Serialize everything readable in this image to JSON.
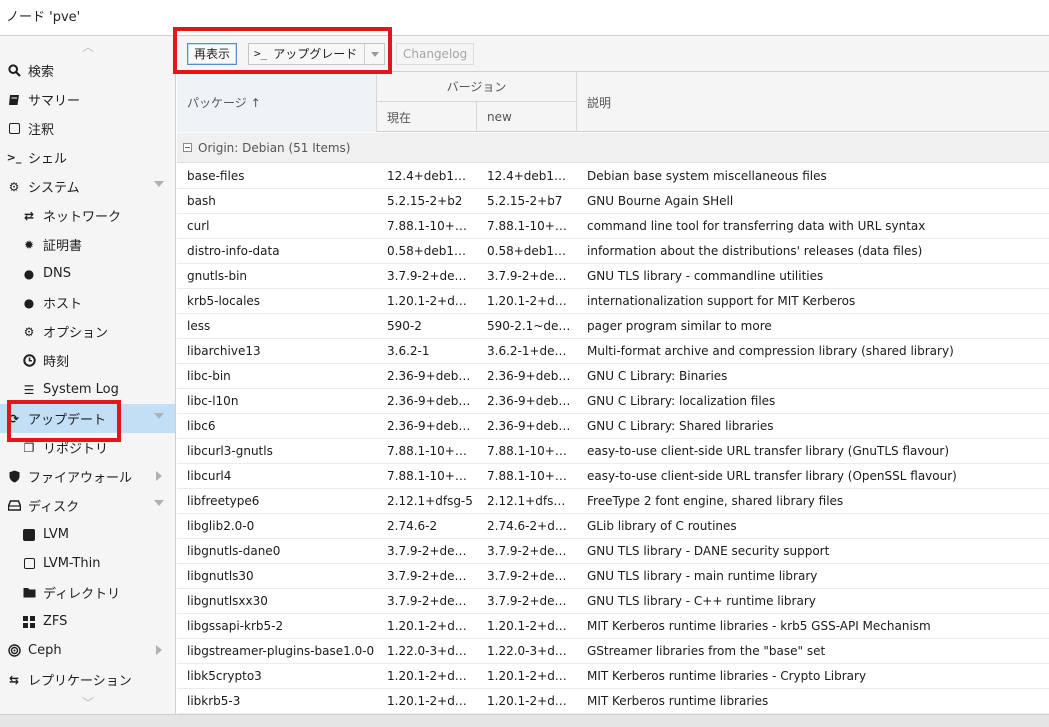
{
  "window": {
    "title": "ノード 'pve'"
  },
  "sidebar": {
    "items": [
      {
        "label": "検索",
        "icon": "search-icon",
        "name": "sidebar-item-search"
      },
      {
        "label": "サマリー",
        "icon": "book-icon",
        "name": "sidebar-item-summary"
      },
      {
        "label": "注釈",
        "icon": "note-icon",
        "name": "sidebar-item-notes"
      },
      {
        "label": "シェル",
        "icon": "terminal-icon",
        "name": "sidebar-item-shell"
      },
      {
        "label": "システム",
        "icon": "gears-icon",
        "name": "sidebar-item-system"
      },
      {
        "label": "ネットワーク",
        "icon": "exchange-icon",
        "name": "sidebar-item-network"
      },
      {
        "label": "証明書",
        "icon": "certificate-icon",
        "name": "sidebar-item-certificates"
      },
      {
        "label": "DNS",
        "icon": "globe-icon",
        "name": "sidebar-item-dns"
      },
      {
        "label": "ホスト",
        "icon": "globe-icon",
        "name": "sidebar-item-hosts"
      },
      {
        "label": "オプション",
        "icon": "gear-icon",
        "name": "sidebar-item-options"
      },
      {
        "label": "時刻",
        "icon": "clock-icon",
        "name": "sidebar-item-time"
      },
      {
        "label": "System Log",
        "icon": "list-icon",
        "name": "sidebar-item-syslog"
      },
      {
        "label": "アップデート",
        "icon": "refresh-icon",
        "name": "sidebar-item-updates"
      },
      {
        "label": "リポジトリ",
        "icon": "files-icon",
        "name": "sidebar-item-repositories"
      },
      {
        "label": "ファイアウォール",
        "icon": "shield-icon",
        "name": "sidebar-item-firewall"
      },
      {
        "label": "ディスク",
        "icon": "hdd-icon",
        "name": "sidebar-item-disks"
      },
      {
        "label": "LVM",
        "icon": "square-icon",
        "name": "sidebar-item-lvm"
      },
      {
        "label": "LVM-Thin",
        "icon": "square-outline-icon",
        "name": "sidebar-item-lvm-thin"
      },
      {
        "label": "ディレクトリ",
        "icon": "folder-icon",
        "name": "sidebar-item-directory"
      },
      {
        "label": "ZFS",
        "icon": "grid-icon",
        "name": "sidebar-item-zfs"
      },
      {
        "label": "Ceph",
        "icon": "ceph-icon",
        "name": "sidebar-item-ceph"
      },
      {
        "label": "レプリケーション",
        "icon": "retweet-icon",
        "name": "sidebar-item-replication"
      }
    ]
  },
  "toolbar": {
    "reload_label": "再表示",
    "upgrade_prompt": ">_",
    "upgrade_label": "アップグレード",
    "changelog_label": "Changelog"
  },
  "grid": {
    "headers": {
      "package": "パッケージ ↑",
      "version": "バージョン",
      "current": "現在",
      "new": "new",
      "description": "説明"
    },
    "group_label": "Origin: Debian (51 Items)",
    "rows": [
      {
        "pkg": "base-files",
        "cur": "12.4+deb1…",
        "new": "12.4+deb1…",
        "desc": "Debian base system miscellaneous files"
      },
      {
        "pkg": "bash",
        "cur": "5.2.15-2+b2",
        "new": "5.2.15-2+b7",
        "desc": "GNU Bourne Again SHell"
      },
      {
        "pkg": "curl",
        "cur": "7.88.1-10+…",
        "new": "7.88.1-10+…",
        "desc": "command line tool for transferring data with URL syntax"
      },
      {
        "pkg": "distro-info-data",
        "cur": "0.58+deb1…",
        "new": "0.58+deb1…",
        "desc": "information about the distributions' releases (data files)"
      },
      {
        "pkg": "gnutls-bin",
        "cur": "3.7.9-2+de…",
        "new": "3.7.9-2+de…",
        "desc": "GNU TLS library - commandline utilities"
      },
      {
        "pkg": "krb5-locales",
        "cur": "1.20.1-2+d…",
        "new": "1.20.1-2+d…",
        "desc": "internationalization support for MIT Kerberos"
      },
      {
        "pkg": "less",
        "cur": "590-2",
        "new": "590-2.1~de…",
        "desc": "pager program similar to more"
      },
      {
        "pkg": "libarchive13",
        "cur": "3.6.2-1",
        "new": "3.6.2-1+de…",
        "desc": "Multi-format archive and compression library (shared library)"
      },
      {
        "pkg": "libc-bin",
        "cur": "2.36-9+deb…",
        "new": "2.36-9+deb…",
        "desc": "GNU C Library: Binaries"
      },
      {
        "pkg": "libc-l10n",
        "cur": "2.36-9+deb…",
        "new": "2.36-9+deb…",
        "desc": "GNU C Library: localization files"
      },
      {
        "pkg": "libc6",
        "cur": "2.36-9+deb…",
        "new": "2.36-9+deb…",
        "desc": "GNU C Library: Shared libraries"
      },
      {
        "pkg": "libcurl3-gnutls",
        "cur": "7.88.1-10+…",
        "new": "7.88.1-10+…",
        "desc": "easy-to-use client-side URL transfer library (GnuTLS flavour)"
      },
      {
        "pkg": "libcurl4",
        "cur": "7.88.1-10+…",
        "new": "7.88.1-10+…",
        "desc": "easy-to-use client-side URL transfer library (OpenSSL flavour)"
      },
      {
        "pkg": "libfreetype6",
        "cur": "2.12.1+dfsg-5",
        "new": "2.12.1+dfs…",
        "desc": "FreeType 2 font engine, shared library files"
      },
      {
        "pkg": "libglib2.0-0",
        "cur": "2.74.6-2",
        "new": "2.74.6-2+d…",
        "desc": "GLib library of C routines"
      },
      {
        "pkg": "libgnutls-dane0",
        "cur": "3.7.9-2+de…",
        "new": "3.7.9-2+de…",
        "desc": "GNU TLS library - DANE security support"
      },
      {
        "pkg": "libgnutls30",
        "cur": "3.7.9-2+de…",
        "new": "3.7.9-2+de…",
        "desc": "GNU TLS library - main runtime library"
      },
      {
        "pkg": "libgnutlsxx30",
        "cur": "3.7.9-2+de…",
        "new": "3.7.9-2+de…",
        "desc": "GNU TLS library - C++ runtime library"
      },
      {
        "pkg": "libgssapi-krb5-2",
        "cur": "1.20.1-2+d…",
        "new": "1.20.1-2+d…",
        "desc": "MIT Kerberos runtime libraries - krb5 GSS-API Mechanism"
      },
      {
        "pkg": "libgstreamer-plugins-base1.0-0",
        "cur": "1.22.0-3+d…",
        "new": "1.22.0-3+d…",
        "desc": "GStreamer libraries from the \"base\" set"
      },
      {
        "pkg": "libk5crypto3",
        "cur": "1.20.1-2+d…",
        "new": "1.20.1-2+d…",
        "desc": "MIT Kerberos runtime libraries - Crypto Library"
      },
      {
        "pkg": "libkrb5-3",
        "cur": "1.20.1-2+d…",
        "new": "1.20.1-2+d…",
        "desc": "MIT Kerberos runtime libraries"
      }
    ]
  },
  "colors": {
    "highlight": "#e1161c",
    "active_row": "#c3dff5"
  }
}
